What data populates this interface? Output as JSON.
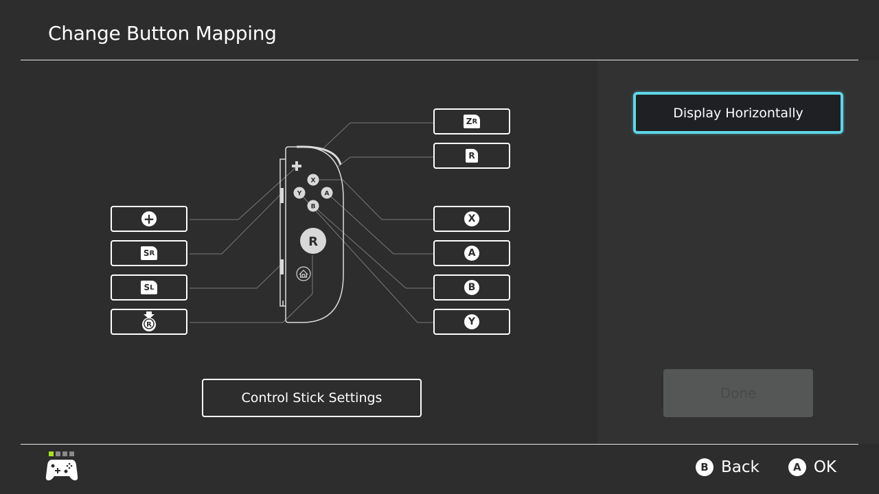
{
  "header": {
    "title": "Change Button Mapping"
  },
  "diagram": {
    "left_mappings": [
      {
        "id": "plus",
        "glyph": "+",
        "glyph_type": "circle-plus",
        "icon": "plus-icon"
      },
      {
        "id": "sr",
        "glyph": "SR",
        "glyph_type": "tag",
        "icon": "sr-button-icon"
      },
      {
        "id": "sl",
        "glyph": "SL",
        "glyph_type": "tag",
        "icon": "sl-button-icon"
      },
      {
        "id": "rstick-press",
        "glyph": "R",
        "glyph_type": "stick-press",
        "icon": "right-stick-press-icon"
      }
    ],
    "right_mappings": [
      {
        "id": "zr",
        "glyph": "ZR",
        "glyph_type": "tag",
        "icon": "zr-button-icon"
      },
      {
        "id": "r",
        "glyph": "R",
        "glyph_type": "tag",
        "icon": "r-button-icon"
      },
      {
        "id": "x",
        "glyph": "X",
        "glyph_type": "circle",
        "icon": "x-button-icon"
      },
      {
        "id": "a",
        "glyph": "A",
        "glyph_type": "circle",
        "icon": "a-button-icon"
      },
      {
        "id": "b",
        "glyph": "B",
        "glyph_type": "circle",
        "icon": "b-button-icon"
      },
      {
        "id": "y",
        "glyph": "Y",
        "glyph_type": "circle",
        "icon": "y-button-icon"
      }
    ],
    "joycon_labels": {
      "x": "X",
      "y": "Y",
      "a": "A",
      "b": "B",
      "stick": "R",
      "plus": "+"
    },
    "control_stick_button": "Control Stick Settings"
  },
  "side_panel": {
    "display_horizontally": "Display Horizontally",
    "done": "Done",
    "done_enabled": false
  },
  "footer": {
    "player_indicator": {
      "total": 4,
      "active": 1,
      "active_color": "#a8e21a"
    },
    "actions": [
      {
        "glyph": "B",
        "label": "Back"
      },
      {
        "glyph": "A",
        "label": "OK"
      }
    ]
  },
  "colors": {
    "background": "#2d2d2d",
    "panel": "#323232",
    "focus": "#5ed6e6",
    "disabled_button": "#545756"
  }
}
